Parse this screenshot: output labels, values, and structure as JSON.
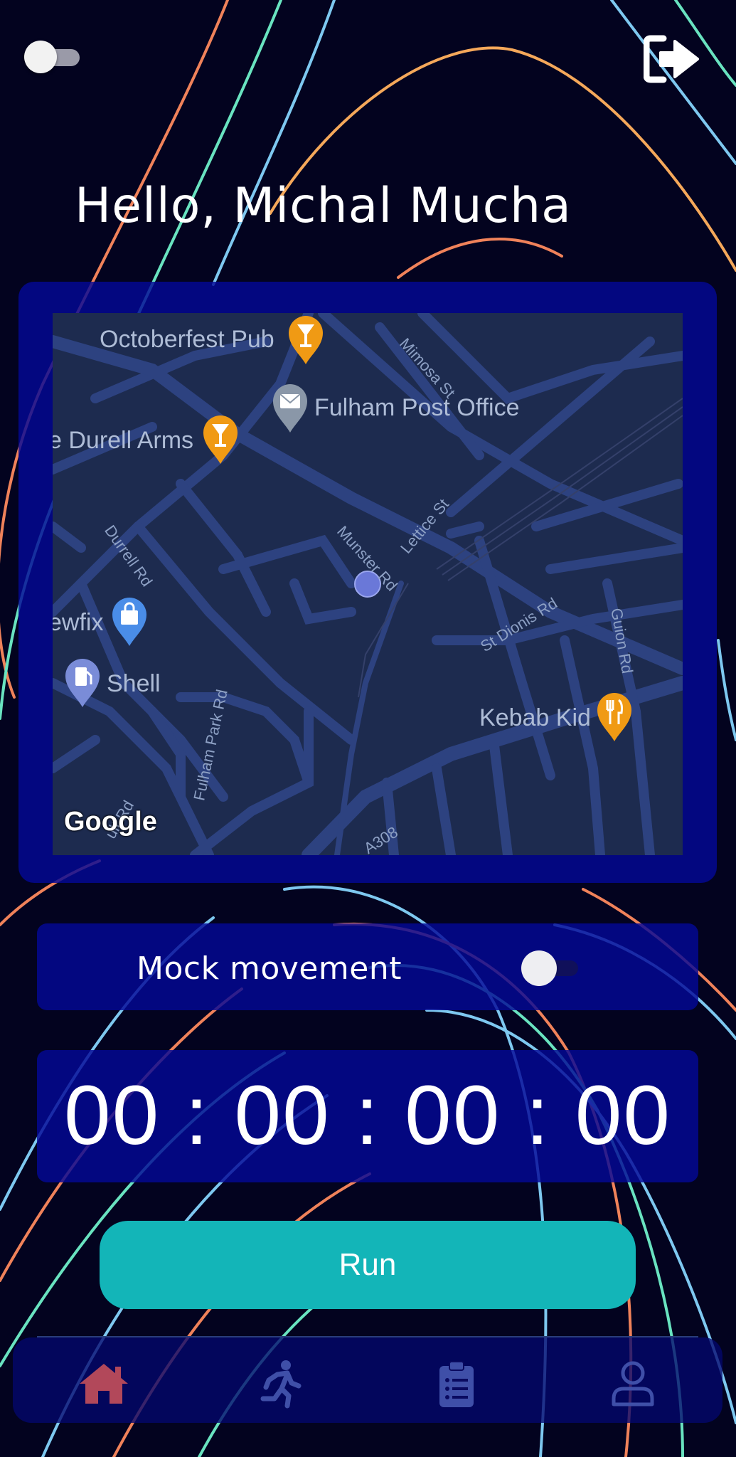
{
  "header": {
    "greeting": "Hello, Michal Mucha",
    "theme_toggle": "off",
    "logout_icon": "logout-icon"
  },
  "map": {
    "attribution": "Google",
    "pois": [
      {
        "label": "Octoberfest Pub",
        "icon": "bar-icon"
      },
      {
        "label": "Fulham Post Office",
        "icon": "mail-icon"
      },
      {
        "label": "e Durell Arms",
        "icon": "bar-icon"
      },
      {
        "label": "ewfix",
        "icon": "shopping-icon"
      },
      {
        "label": "Shell",
        "icon": "fuel-icon"
      },
      {
        "label": "Kebab Kid",
        "icon": "restaurant-icon"
      }
    ],
    "streets": [
      "Mimosa St",
      "Lettice St",
      "Munster Rd",
      "Durrell Rd",
      "St Dionis Rd",
      "Guion Rd",
      "Fulham Park Rd",
      "ult Rd",
      "A308"
    ]
  },
  "mock_movement": {
    "label": "Mock movement",
    "enabled": false
  },
  "timer": {
    "display": "00 : 00 : 00 : 00"
  },
  "actions": {
    "run_label": "Run"
  },
  "bottom_nav": {
    "items": [
      {
        "icon": "home-icon",
        "active": true
      },
      {
        "icon": "running-icon",
        "active": false
      },
      {
        "icon": "clipboard-list-icon",
        "active": false
      },
      {
        "icon": "user-icon",
        "active": false
      }
    ]
  },
  "colors": {
    "background": "#03031f",
    "card": "#0408a0",
    "accent": "#13b5b8",
    "active_nav": "#c0485a"
  }
}
